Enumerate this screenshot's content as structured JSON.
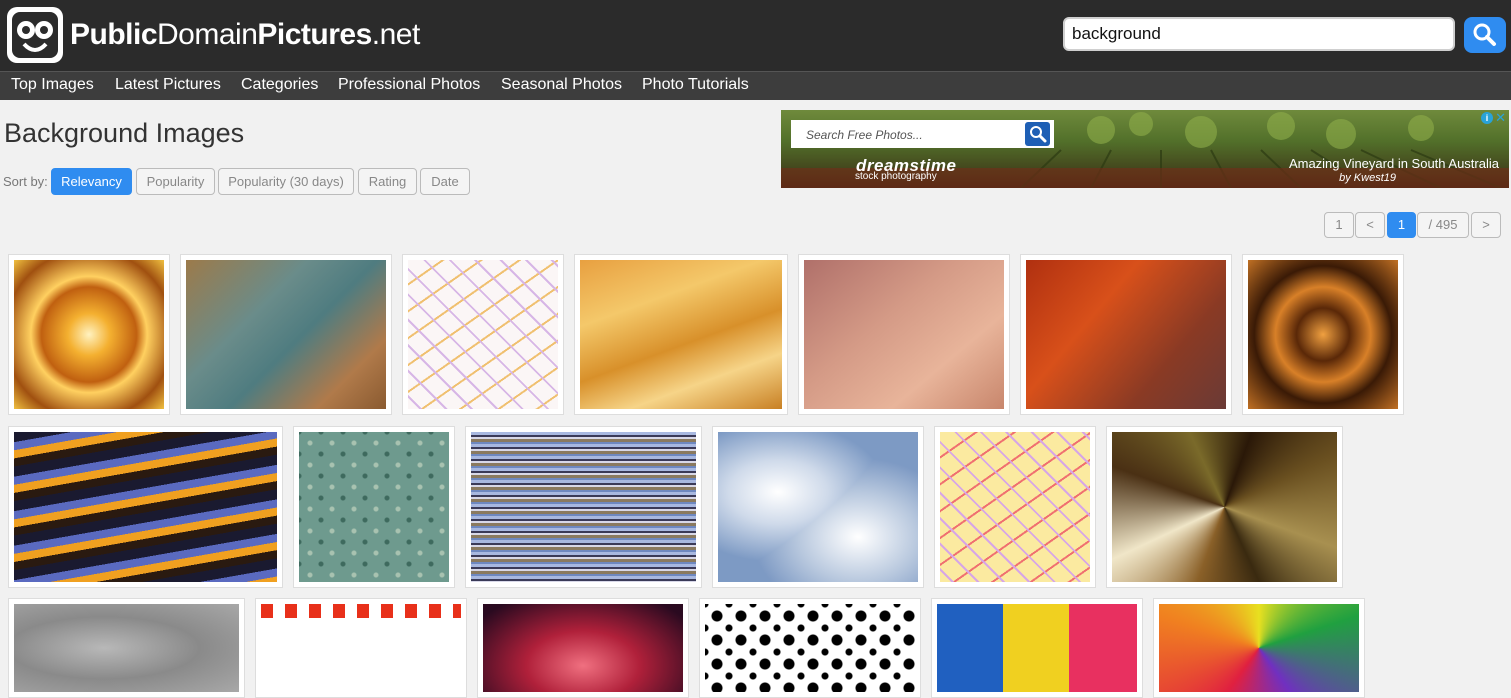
{
  "site": {
    "name_bold1": "Public",
    "name_regular": "Domain",
    "name_bold2": "Pictures",
    "name_tld": ".net"
  },
  "search": {
    "value": "background"
  },
  "nav": {
    "items": [
      "Top Images",
      "Latest Pictures",
      "Categories",
      "Professional Photos",
      "Seasonal Photos",
      "Photo Tutorials"
    ]
  },
  "page": {
    "title": "Background Images"
  },
  "sort": {
    "label": "Sort by:",
    "options": [
      "Relevancy",
      "Popularity",
      "Popularity (30 days)",
      "Rating",
      "Date"
    ],
    "active": "Relevancy"
  },
  "ad": {
    "search_placeholder": "Search Free Photos...",
    "brand": "dreamstime",
    "brand_sub": "stock photography",
    "caption": "Amazing Vineyard in South Australia",
    "byline": "by Kwest19",
    "info": "i",
    "close": "✕"
  },
  "pagination": {
    "first": "1",
    "prev": "<",
    "current": "1",
    "total": "/ 495",
    "next": ">"
  },
  "colors": {
    "accent": "#2f8cf0",
    "header_bg": "#2b2b2b",
    "nav_bg": "#3d3d3d"
  },
  "thumbnails": [
    {
      "id": "fractal-gold"
    },
    {
      "id": "blur-teal-brown"
    },
    {
      "id": "confetti-white"
    },
    {
      "id": "golden-waves"
    },
    {
      "id": "pink-blur"
    },
    {
      "id": "orange-blur"
    },
    {
      "id": "brown-kaleido"
    },
    {
      "id": "orange-swirl"
    },
    {
      "id": "green-pattern"
    },
    {
      "id": "stripes"
    },
    {
      "id": "clouds"
    },
    {
      "id": "confetti-yellow"
    },
    {
      "id": "mosaic"
    },
    {
      "id": "grey-marble"
    },
    {
      "id": "hearts-frame"
    },
    {
      "id": "you-my-heart"
    },
    {
      "id": "black-white-pattern"
    },
    {
      "id": "peace-love"
    },
    {
      "id": "heart-mosaic"
    }
  ]
}
